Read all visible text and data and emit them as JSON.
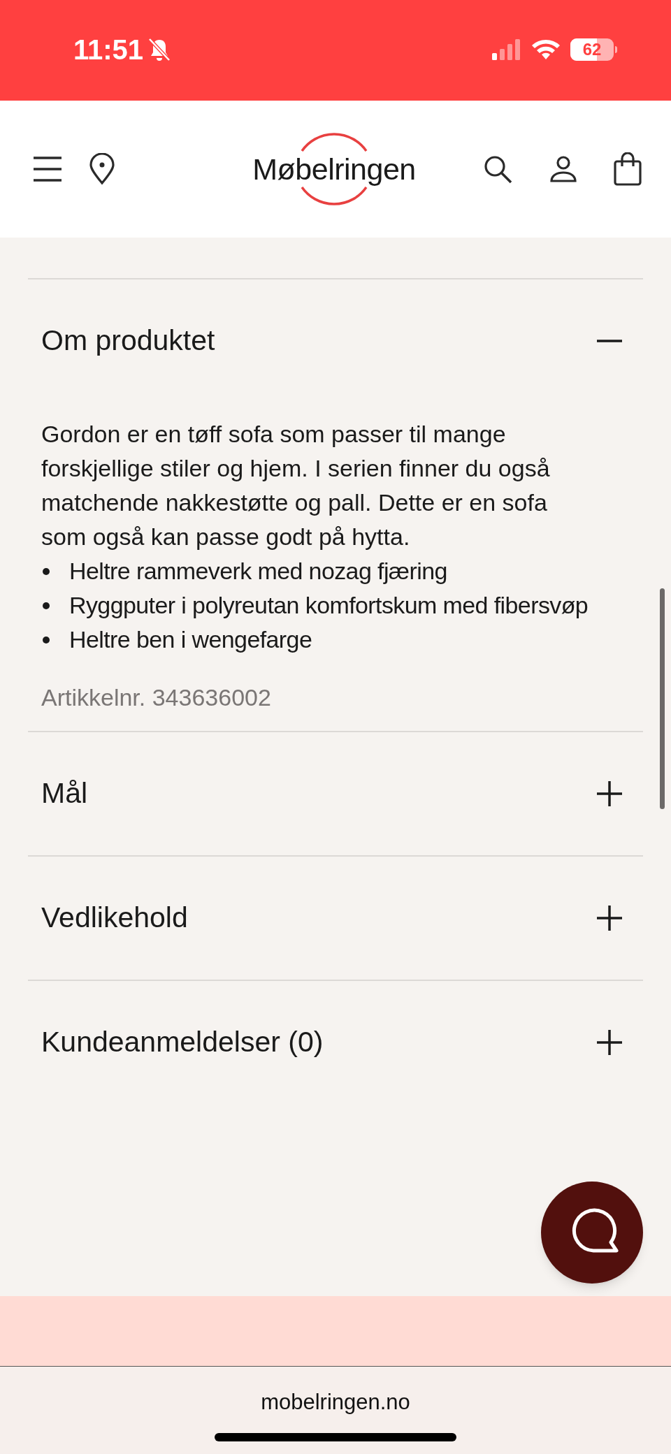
{
  "status_bar": {
    "time": "11:51",
    "battery": "62"
  },
  "header": {
    "logo": "Møbelringen"
  },
  "sections": [
    {
      "title": "Om produktet",
      "expanded": true,
      "description": "Gordon er en tøff sofa som passer til mange forskjellige stiler og hjem. I serien finner du også matchende nakkestøtte og pall. Dette er en sofa som også kan passe godt på hytta.",
      "bullets": [
        "Heltre rammeverk med nozag fjæring",
        "Ryggputer i polyreutan komfortskum med fibersvøp",
        "Heltre ben i wengefarge"
      ],
      "article_number": "Artikkelnr. 343636002"
    },
    {
      "title": "Mål",
      "expanded": false
    },
    {
      "title": "Vedlikehold",
      "expanded": false
    },
    {
      "title": "Kundeanmeldelser (0)",
      "expanded": false
    }
  ],
  "browser": {
    "url": "mobelringen.no"
  }
}
